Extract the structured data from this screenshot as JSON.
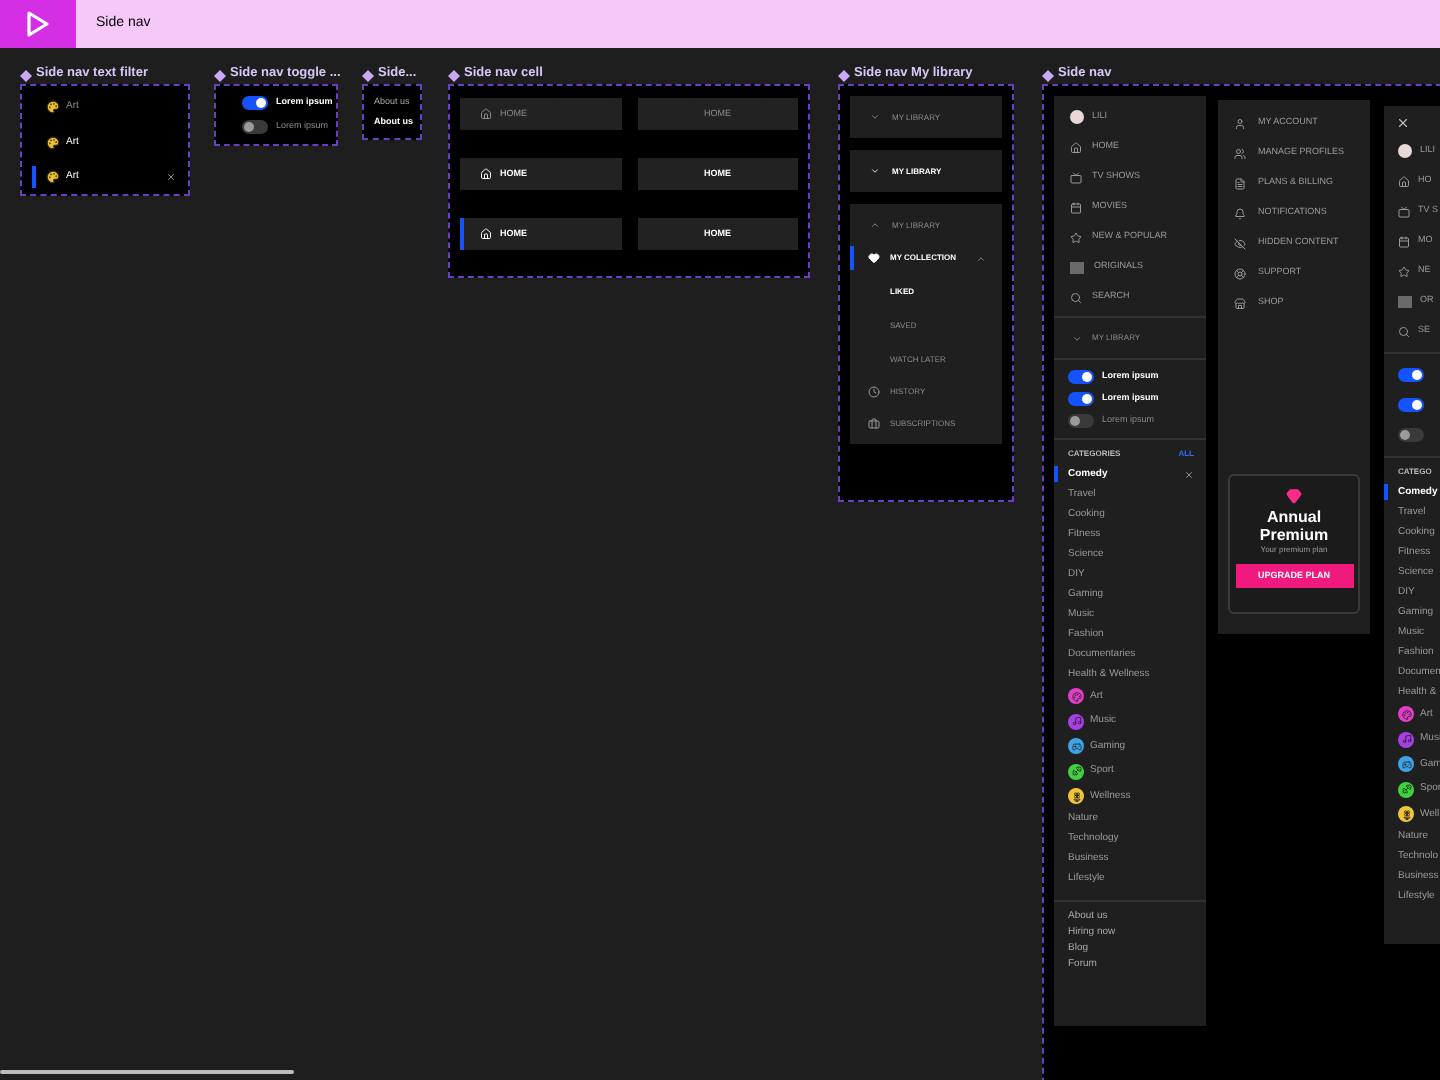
{
  "header": {
    "title": "Side nav"
  },
  "text_filter": {
    "title": "Side nav text filter",
    "items": [
      {
        "label": "Art",
        "hovered": false,
        "selected": false
      },
      {
        "label": "Art",
        "hovered": true,
        "selected": false
      },
      {
        "label": "Art",
        "hovered": true,
        "selected": true
      }
    ]
  },
  "toggle_frame": {
    "title": "Side nav toggle ...",
    "toggles": [
      {
        "label": "Lorem ipsum",
        "on": true
      },
      {
        "label": "Lorem ipsum",
        "on": false
      }
    ]
  },
  "link_frame": {
    "title": "Side...",
    "links": [
      {
        "label": "About us",
        "hovered": false
      },
      {
        "label": "About us",
        "hovered": true
      }
    ]
  },
  "cell_frame": {
    "title": "Side nav cell",
    "cells": [
      {
        "kind": "icon",
        "label": "HOME",
        "hovered": false,
        "selected": false
      },
      {
        "kind": "text",
        "label": "HOME",
        "hovered": false,
        "selected": false
      },
      {
        "kind": "icon",
        "label": "HOME",
        "hovered": true,
        "selected": false
      },
      {
        "kind": "text",
        "label": "HOME",
        "hovered": true,
        "selected": false
      },
      {
        "kind": "icon",
        "label": "HOME",
        "hovered": true,
        "selected": true
      },
      {
        "kind": "text",
        "label": "HOME",
        "hovered": true,
        "selected": false
      }
    ]
  },
  "library_frame": {
    "title": "Side nav My library",
    "variants": [
      {
        "label": "MY LIBRARY",
        "hovered": false,
        "expanded": false
      },
      {
        "label": "MY LIBRARY",
        "hovered": true,
        "expanded": false
      },
      {
        "label": "MY LIBRARY",
        "hovered": false,
        "expanded": true,
        "children": [
          {
            "label": "MY COLLECTION",
            "selected": true,
            "expanded": true,
            "children": [
              {
                "label": "LIKED",
                "selected": true
              },
              {
                "label": "SAVED",
                "selected": false
              },
              {
                "label": "WATCH LATER",
                "selected": false
              }
            ]
          },
          {
            "label": "HISTORY",
            "selected": false
          },
          {
            "label": "SUBSCRIPTIONS",
            "selected": false
          }
        ]
      }
    ]
  },
  "side_nav": {
    "title": "Side nav",
    "main_panel": {
      "profile": "LILI",
      "nav_items": [
        "HOME",
        "TV SHOWS",
        "MOVIES",
        "NEW & POPULAR",
        "ORIGINALS",
        "SEARCH"
      ],
      "my_library": {
        "label": "MY LIBRARY",
        "expanded": false
      },
      "toggles": [
        {
          "label": "Lorem ipsum",
          "on": true
        },
        {
          "label": "Lorem ipsum",
          "on": true
        },
        {
          "label": "Lorem ipsum",
          "on": false
        }
      ],
      "categories": {
        "header": "CATEGORIES",
        "action": "ALL",
        "items": [
          {
            "kind": "plain",
            "label": "Comedy",
            "selected": true
          },
          {
            "kind": "plain",
            "label": "Travel",
            "selected": false
          },
          {
            "kind": "plain",
            "label": "Cooking",
            "selected": false
          },
          {
            "kind": "plain",
            "label": "Fitness",
            "selected": false
          },
          {
            "kind": "plain",
            "label": "Science",
            "selected": false
          },
          {
            "kind": "plain",
            "label": "DIY",
            "selected": false
          },
          {
            "kind": "plain",
            "label": "Gaming",
            "selected": false
          },
          {
            "kind": "plain",
            "label": "Music",
            "selected": false
          },
          {
            "kind": "plain",
            "label": "Fashion",
            "selected": false
          },
          {
            "kind": "plain",
            "label": "Documentaries",
            "selected": false
          },
          {
            "kind": "plain",
            "label": "Health & Wellness",
            "selected": false
          },
          {
            "kind": "icon",
            "label": "Art",
            "selected": false,
            "color": "#e13fc8"
          },
          {
            "kind": "icon",
            "label": "Music",
            "selected": false,
            "color": "#a83ee6"
          },
          {
            "kind": "icon",
            "label": "Gaming",
            "selected": false,
            "color": "#3fa3e8"
          },
          {
            "kind": "icon",
            "label": "Sport",
            "selected": false,
            "color": "#3fd13f"
          },
          {
            "kind": "icon",
            "label": "Wellness",
            "selected": false,
            "color": "#f0c53a"
          },
          {
            "kind": "plain",
            "label": "Nature",
            "selected": false
          },
          {
            "kind": "plain",
            "label": "Technology",
            "selected": false
          },
          {
            "kind": "plain",
            "label": "Business",
            "selected": false
          },
          {
            "kind": "plain",
            "label": "Lifestyle",
            "selected": false
          }
        ]
      },
      "footer_links": [
        "About us",
        "Hiring now",
        "Blog",
        "Forum"
      ]
    },
    "account_panel": {
      "items": [
        "MY ACCOUNT",
        "MANAGE PROFILES",
        "PLANS & BILLING",
        "NOTIFICATIONS",
        "HIDDEN CONTENT",
        "SUPPORT",
        "SHOP"
      ],
      "premium_card": {
        "title": "Annual Premium",
        "subtitle": "Your premium plan",
        "button": "UPGRADE PLAN"
      }
    },
    "closable_panel": {
      "profile": "LILI",
      "nav_items": [
        "HO",
        "TV S",
        "MO",
        "NE",
        "OR",
        "SE"
      ],
      "toggles": [
        {
          "on": true
        },
        {
          "on": true
        },
        {
          "on": false
        }
      ],
      "categories": {
        "header": "CATEGO",
        "items": [
          {
            "kind": "plain",
            "label": "Comedy",
            "selected": true
          },
          {
            "kind": "plain",
            "label": "Travel",
            "selected": false
          },
          {
            "kind": "plain",
            "label": "Cooking",
            "selected": false
          },
          {
            "kind": "plain",
            "label": "Fitness",
            "selected": false
          },
          {
            "kind": "plain",
            "label": "Science",
            "selected": false
          },
          {
            "kind": "plain",
            "label": "DIY",
            "selected": false
          },
          {
            "kind": "plain",
            "label": "Gaming",
            "selected": false
          },
          {
            "kind": "plain",
            "label": "Music",
            "selected": false
          },
          {
            "kind": "plain",
            "label": "Fashion",
            "selected": false
          },
          {
            "kind": "plain",
            "label": "Documen",
            "selected": false
          },
          {
            "kind": "plain",
            "label": "Health &",
            "selected": false
          },
          {
            "kind": "icon",
            "label": "Art",
            "selected": false,
            "color": "#e13fc8"
          },
          {
            "kind": "icon",
            "label": "Musi",
            "selected": false,
            "color": "#a83ee6"
          },
          {
            "kind": "icon",
            "label": "Gam",
            "selected": false,
            "color": "#3fa3e8"
          },
          {
            "kind": "icon",
            "label": "Spor",
            "selected": false,
            "color": "#3fd13f"
          },
          {
            "kind": "icon",
            "label": "Well",
            "selected": false,
            "color": "#f0c53a"
          },
          {
            "kind": "plain",
            "label": "Nature",
            "selected": false
          },
          {
            "kind": "plain",
            "label": "Technolo",
            "selected": false
          },
          {
            "kind": "plain",
            "label": "Business",
            "selected": false
          },
          {
            "kind": "plain",
            "label": "Lifestyle",
            "selected": false
          }
        ]
      }
    }
  }
}
